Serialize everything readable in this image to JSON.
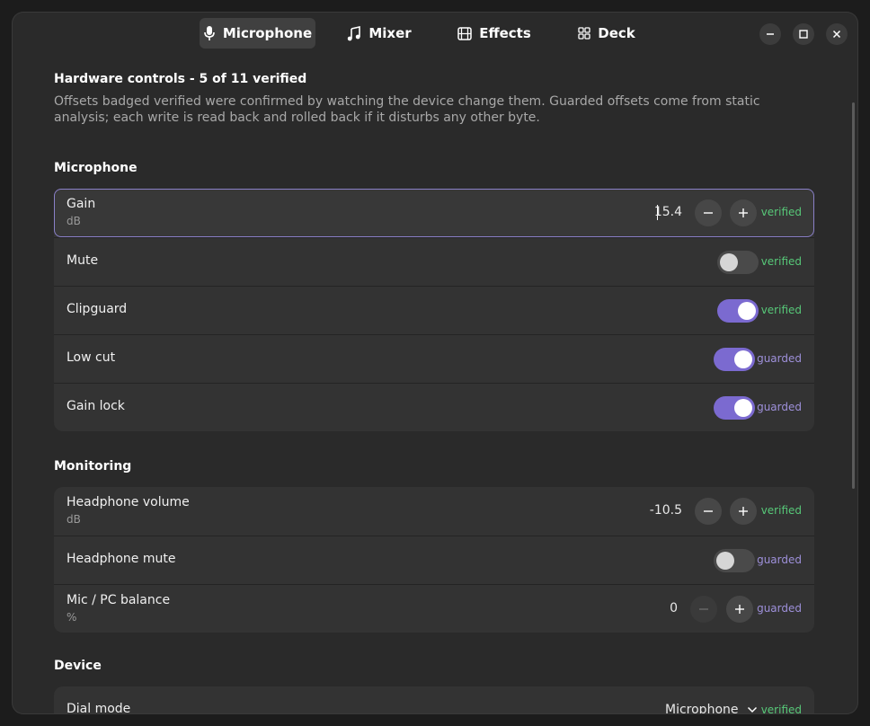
{
  "tabs": [
    {
      "label": "Microphone",
      "icon": "microphone-icon",
      "active": true
    },
    {
      "label": "Mixer",
      "icon": "music-note-icon",
      "active": false
    },
    {
      "label": "Effects",
      "icon": "film-icon",
      "active": false
    },
    {
      "label": "Deck",
      "icon": "grid-icon",
      "active": false
    }
  ],
  "page": {
    "title": "Hardware controls - 5 of 11 verified",
    "description": "Offsets badged verified were confirmed by watching the device change them. Guarded offsets come from static analysis; each write is read back and rolled back if it disturbs any other byte."
  },
  "microphone": {
    "title": "Microphone",
    "gain": {
      "label": "Gain",
      "unit": "dB",
      "value": "15.4",
      "badge": "verified"
    },
    "mute": {
      "label": "Mute",
      "on": false,
      "badge": "verified"
    },
    "clipguard": {
      "label": "Clipguard",
      "on": true,
      "badge": "verified"
    },
    "low_cut": {
      "label": "Low cut",
      "on": true,
      "badge": "guarded"
    },
    "gain_lock": {
      "label": "Gain lock",
      "on": true,
      "badge": "guarded"
    }
  },
  "monitoring": {
    "title": "Monitoring",
    "headphone_volume": {
      "label": "Headphone volume",
      "unit": "dB",
      "value": "-10.5",
      "badge": "verified"
    },
    "headphone_mute": {
      "label": "Headphone mute",
      "on": false,
      "badge": "guarded"
    },
    "balance": {
      "label": "Mic / PC balance",
      "unit": "%",
      "value": "0",
      "badge": "guarded"
    }
  },
  "device": {
    "title": "Device",
    "dial_mode": {
      "label": "Dial mode",
      "value": "Microphone",
      "badge": "verified"
    }
  },
  "colors": {
    "accent": "#7b6ad0",
    "verified": "#57c878",
    "guarded": "#9e90da"
  }
}
